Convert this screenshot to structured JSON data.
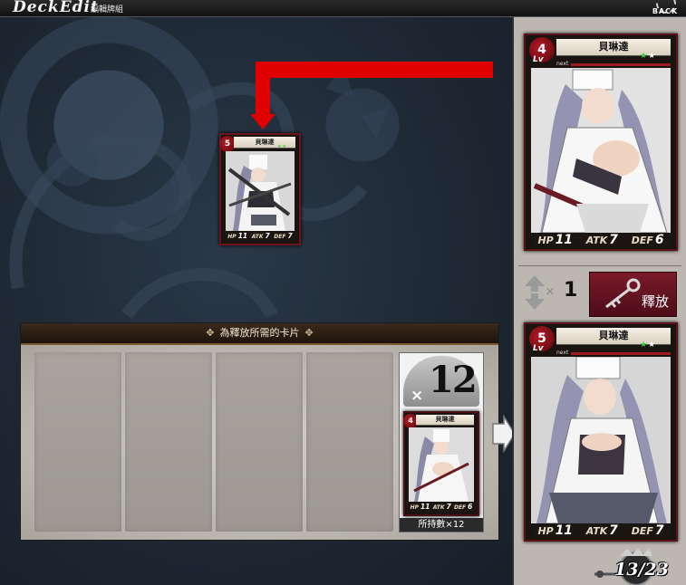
{
  "header": {
    "title": "DeckEdit",
    "subtitle": "編輯牌組",
    "back_label": "BACK"
  },
  "selected_card": {
    "name": "貝琳達",
    "level": "5",
    "lv_label": "Lv",
    "hp_label": "HP",
    "hp": "11",
    "atk_label": "ATK",
    "atk": "7",
    "def_label": "DEF",
    "def": "7"
  },
  "requirement_panel": {
    "title": "為釋放所需的卡片",
    "owned_count": "12",
    "times_symbol": "×",
    "owned_caption": "所持數×12",
    "owned_card": {
      "name": "貝琳達",
      "level": "4",
      "hp": "11",
      "atk": "7",
      "def": "6"
    }
  },
  "current_card": {
    "name": "貝琳達",
    "lv_label": "Lv",
    "level": "4",
    "next_label": "next",
    "hp_label": "HP",
    "hp": "11",
    "atk_label": "ATK",
    "atk": "7",
    "def_label": "DEF",
    "def": "6"
  },
  "release_row": {
    "times_symbol": "×",
    "count": "1",
    "button_label": "釋放"
  },
  "result_card": {
    "name": "貝琳達",
    "lv_label": "Lv",
    "level": "5",
    "next_label": "next",
    "hp_label": "HP",
    "hp": "11",
    "atk_label": "ATK",
    "atk": "7",
    "def_label": "DEF",
    "def": "7"
  },
  "deck_counter": {
    "text": "13/23"
  },
  "colors": {
    "accent_red": "#e00000",
    "card_frame": "#6b1419",
    "release_button": "#6a1526"
  },
  "icons": [
    "back-gear-icon",
    "arrow-down-icon",
    "flow-arrow-right-icon",
    "up-down-icon",
    "key-icon",
    "crown-icon"
  ]
}
